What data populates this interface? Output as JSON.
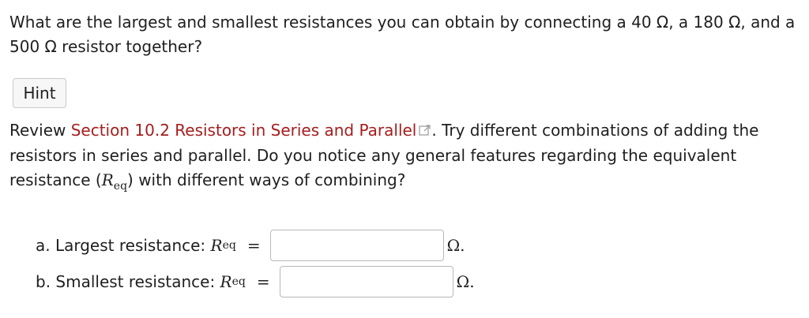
{
  "question": {
    "text": "What are the largest and smallest resistances you can obtain by connecting a 40 Ω, a 180 Ω, and a 500 Ω resistor together?"
  },
  "hint_button": {
    "label": "Hint"
  },
  "hint": {
    "prefix": "Review ",
    "link_text": "Section 10.2 Resistors in Series and Parallel",
    "after_link": ". Try different combinations of adding the resistors in series and parallel. Do you notice any general features regarding the equivalent resistance (",
    "var_symbol": "R",
    "var_subscript": "eq",
    "suffix": ") with different ways of combining?",
    "link_icon": "external-link-icon"
  },
  "parts": [
    {
      "label": "a. Largest resistance: ",
      "var_symbol": "R",
      "var_subscript": "eq",
      "equals": "=",
      "value": "",
      "unit": "Ω."
    },
    {
      "label": "b. Smallest resistance: ",
      "var_symbol": "R",
      "var_subscript": "eq",
      "equals": "=",
      "value": "",
      "unit": "Ω."
    }
  ],
  "colors": {
    "text": "#1f1f1f",
    "link": "#a51e1e",
    "button_bg": "#f7f7f7",
    "border": "#c9c9c9"
  }
}
